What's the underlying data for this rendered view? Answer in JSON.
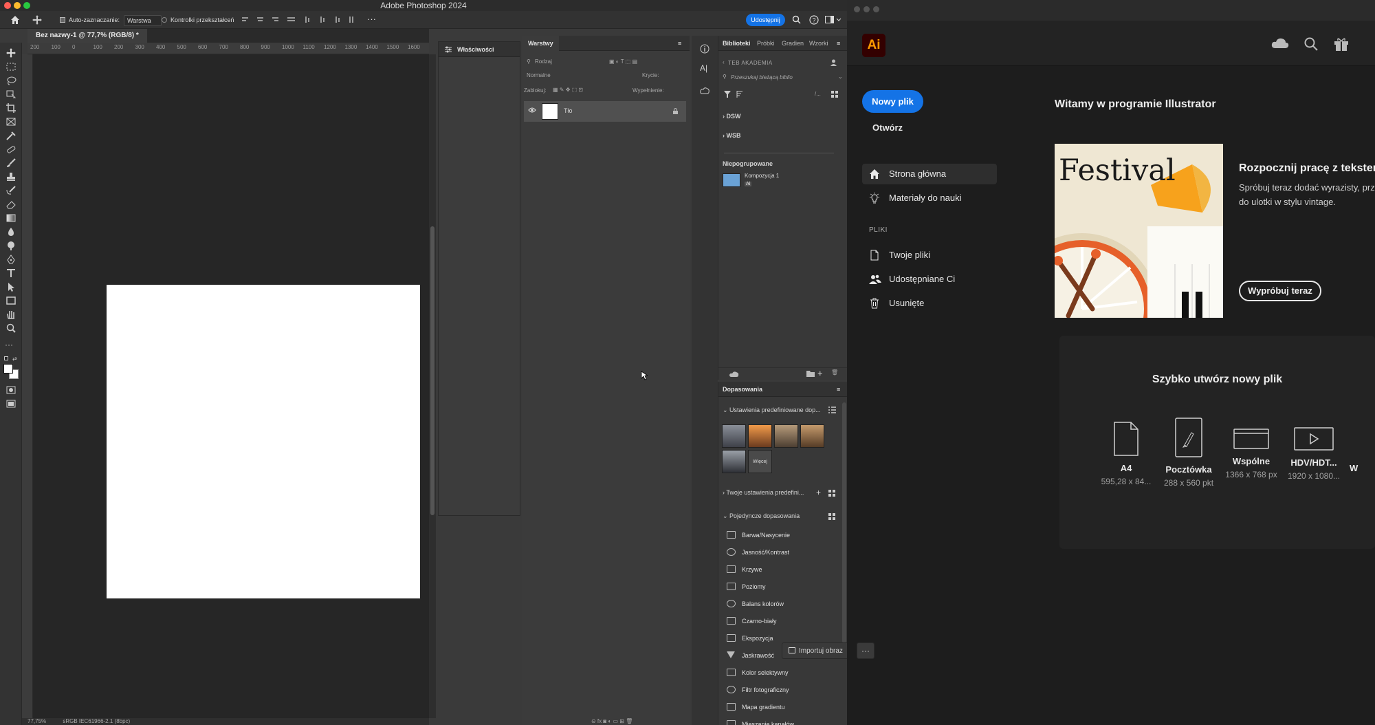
{
  "photoshop": {
    "window_title": "Adobe Photoshop 2024",
    "options": {
      "auto_select_label": "Auto-zaznaczanie:",
      "auto_select_value": "Warstwa",
      "transform_controls_label": "Kontrolki przekształceń",
      "share_label": "Udostępnij"
    },
    "document_tab": "Bez nazwy-1 @ 77,7% (RGB/8) *",
    "ruler_ticks": [
      "200",
      "100",
      "0",
      "100",
      "200",
      "300",
      "400",
      "500",
      "600",
      "700",
      "800",
      "900",
      "1000",
      "1100",
      "1200",
      "1300",
      "1400",
      "1500",
      "1600"
    ],
    "status": {
      "zoom": "77,75%",
      "profile": "sRGB IEC61966-2.1 (8bpc)"
    },
    "properties_panel": {
      "title": "Właściwości"
    },
    "layers_panel": {
      "title": "Warstwy",
      "filter_placeholder": "Rodzaj",
      "blend_mode": "Normalne",
      "opacity_label": "Krycie:",
      "lock_label": "Zablokuj:",
      "fill_label": "Wypełnienie:",
      "layers": [
        {
          "name": "Tło"
        }
      ]
    },
    "libraries_panel": {
      "tabs": [
        "Biblioteki",
        "Próbki",
        "Gradien",
        "Wzorki"
      ],
      "breadcrumb": "TEB AKADEMIA",
      "search_placeholder": "Przeszukaj bieżącą biblio",
      "groups": [
        "DSW",
        "WSB"
      ],
      "ungrouped_header": "Niepogrupowane",
      "item_name": "Kompozycja 1",
      "item_badge": "Ai"
    },
    "adjustments_panel": {
      "title": "Dopasowania",
      "presets_header": "Ustawienia predefiniowane dop...",
      "more_label": "Więcej",
      "your_presets_header": "Twoje ustawienia predefini...",
      "single_header": "Pojedyncze dopasowania",
      "items": [
        "Barwa/Nasycenie",
        "Jasność/Kontrast",
        "Krzywe",
        "Poziomy",
        "Balans kolorów",
        "Czarno-biały",
        "Ekspozycja",
        "Jaskrawość",
        "Kolor selektywny",
        "Filtr fotograficzny",
        "Mapa gradientu",
        "Mieszanie kanałów"
      ]
    },
    "import_button": "Importuj obraz",
    "import_more": "···"
  },
  "illustrator": {
    "logo": "Ai",
    "new_file": "Nowy plik",
    "open": "Otwórz",
    "nav": [
      {
        "label": "Strona główna",
        "icon": "home-icon"
      },
      {
        "label": "Materiały do nauki",
        "icon": "lightbulb-icon"
      }
    ],
    "files_header": "PLIKI",
    "files_nav": [
      {
        "label": "Twoje pliki",
        "icon": "document-icon"
      },
      {
        "label": "Udostępniane Ci",
        "icon": "people-icon"
      },
      {
        "label": "Usunięte",
        "icon": "trash-icon"
      }
    ],
    "welcome_title": "Witamy w programie Illustrator",
    "promo": {
      "image_text": "Festival",
      "title": "Rozpocznij pracę z tekstem",
      "body_line1": "Spróbuj teraz dodać wyrazisty, przyc",
      "body_line2": "do ulotki w stylu vintage.",
      "button": "Wypróbuj teraz"
    },
    "quick_create": {
      "title": "Szybko utwórz nowy plik",
      "presets": [
        {
          "name": "A4",
          "size": "595,28 x 84..."
        },
        {
          "name": "Pocztówka",
          "size": "288 x 560 pkt"
        },
        {
          "name": "Wspólne",
          "size": "1366 x 768 px"
        },
        {
          "name": "HDV/HDT...",
          "size": "1920 x 1080..."
        },
        {
          "name": "W",
          "size": ""
        }
      ]
    }
  }
}
